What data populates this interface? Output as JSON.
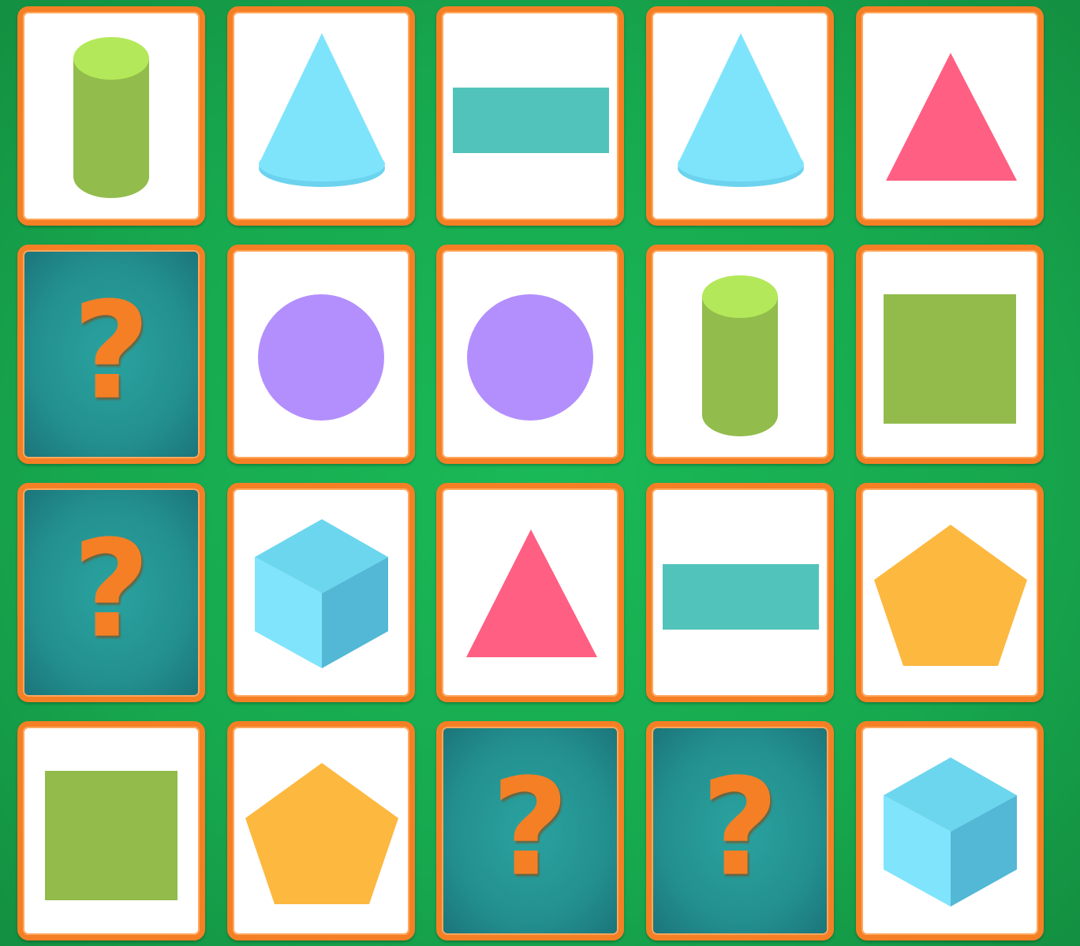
{
  "game": {
    "hidden_symbol": "?",
    "columns": 5,
    "cards": [
      {
        "state": "revealed",
        "shape": "cylinder"
      },
      {
        "state": "revealed",
        "shape": "cone"
      },
      {
        "state": "revealed",
        "shape": "rectangle"
      },
      {
        "state": "revealed",
        "shape": "cone"
      },
      {
        "state": "revealed",
        "shape": "triangle"
      },
      {
        "state": "hidden",
        "shape": null
      },
      {
        "state": "revealed",
        "shape": "circle"
      },
      {
        "state": "revealed",
        "shape": "circle"
      },
      {
        "state": "revealed",
        "shape": "cylinder"
      },
      {
        "state": "revealed",
        "shape": "square"
      },
      {
        "state": "hidden",
        "shape": null
      },
      {
        "state": "revealed",
        "shape": "cube"
      },
      {
        "state": "revealed",
        "shape": "triangle"
      },
      {
        "state": "revealed",
        "shape": "rectangle"
      },
      {
        "state": "revealed",
        "shape": "pentagon"
      },
      {
        "state": "revealed",
        "shape": "square"
      },
      {
        "state": "revealed",
        "shape": "pentagon"
      },
      {
        "state": "hidden",
        "shape": null
      },
      {
        "state": "hidden",
        "shape": null
      },
      {
        "state": "revealed",
        "shape": "cube"
      }
    ]
  },
  "colors": {
    "card_border": "#f57f25",
    "cylinder_body": "#92bc4b",
    "cylinder_top": "#b3e85a",
    "cone": "#7ee4fc",
    "cone_base": "#6cd3ef",
    "rectangle": "#52c3bb",
    "triangle": "#ff5f82",
    "circle": "#b38ffd",
    "square": "#92bb4b",
    "cube_top": "#6cd6ee",
    "cube_left": "#80e4fc",
    "cube_right": "#52b8d5",
    "pentagon": "#fdb840"
  }
}
